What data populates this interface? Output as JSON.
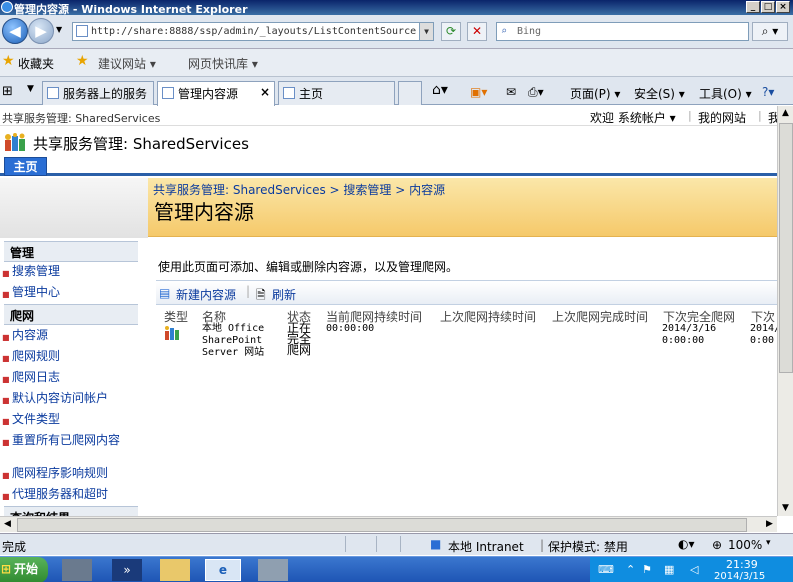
{
  "window": {
    "title": "管理内容源 - Windows Internet Explorer"
  },
  "address": {
    "url": "http://share:8888/ssp/admin/_layouts/ListContentSource",
    "search_placeholder": "Bing"
  },
  "favorites": {
    "label": "收藏夹",
    "items": [
      "建议网站 ▾",
      "网页快讯库 ▾"
    ]
  },
  "tabs": [
    {
      "label": "服务器上的服务",
      "active": false
    },
    {
      "label": "管理内容源",
      "active": true
    },
    {
      "label": "主页",
      "active": false
    }
  ],
  "commandbar": {
    "page": "页面(P) ▾",
    "safety": "安全(S) ▾",
    "tools": "工具(O) ▾"
  },
  "sp": {
    "top_left": "共享服务管理: SharedServices",
    "welcome": "欢迎 系统帐户 ▾",
    "mysite": "我的网站",
    "mylinks": "我",
    "site_title": "共享服务管理: SharedServices",
    "home_tab": "主页",
    "breadcrumb": "共享服务管理: SharedServices > 搜索管理 > 内容源",
    "page_title": "管理内容源",
    "description": "使用此页面可添加、编辑或删除内容源，以及管理爬网。",
    "toolbar": {
      "new_source": "新建内容源",
      "refresh": "刷新"
    }
  },
  "leftnav": {
    "sections": [
      {
        "title": "管理",
        "items": [
          "搜索管理",
          "管理中心"
        ]
      },
      {
        "title": "爬网",
        "items": [
          "内容源",
          "爬网规则",
          "爬网日志",
          "默认内容访问帐户",
          "文件类型",
          "重置所有已爬网内容",
          "爬网程序影响规则",
          "代理服务器和超时"
        ]
      },
      {
        "title": "查询和结果",
        "items": []
      }
    ]
  },
  "grid": {
    "columns": [
      "类型",
      "名称",
      "状态",
      "当前爬网持续时间",
      "上次爬网持续时间",
      "上次爬网完成时间",
      "下次完全爬网",
      "下次"
    ],
    "rows": [
      {
        "name": "本地 Office SharePoint Server 网站",
        "status": "正在完全爬网",
        "current_duration": "00:00:00",
        "last_duration": "",
        "last_completed": "",
        "next_full": "2014/3/16 0:00:00",
        "next_incr": "2014/ 0:00"
      }
    ]
  },
  "status": {
    "left": "完成",
    "zone": "本地 Intranet",
    "protected_mode": "保护模式: 禁用",
    "zoom": "100%"
  },
  "taskbar": {
    "start": "开始",
    "time": "21:39",
    "date": "2014/3/15"
  },
  "colors": {
    "accent": "#2a6ed4",
    "title_area": "#f5c96a",
    "link": "#0b3b9e"
  }
}
